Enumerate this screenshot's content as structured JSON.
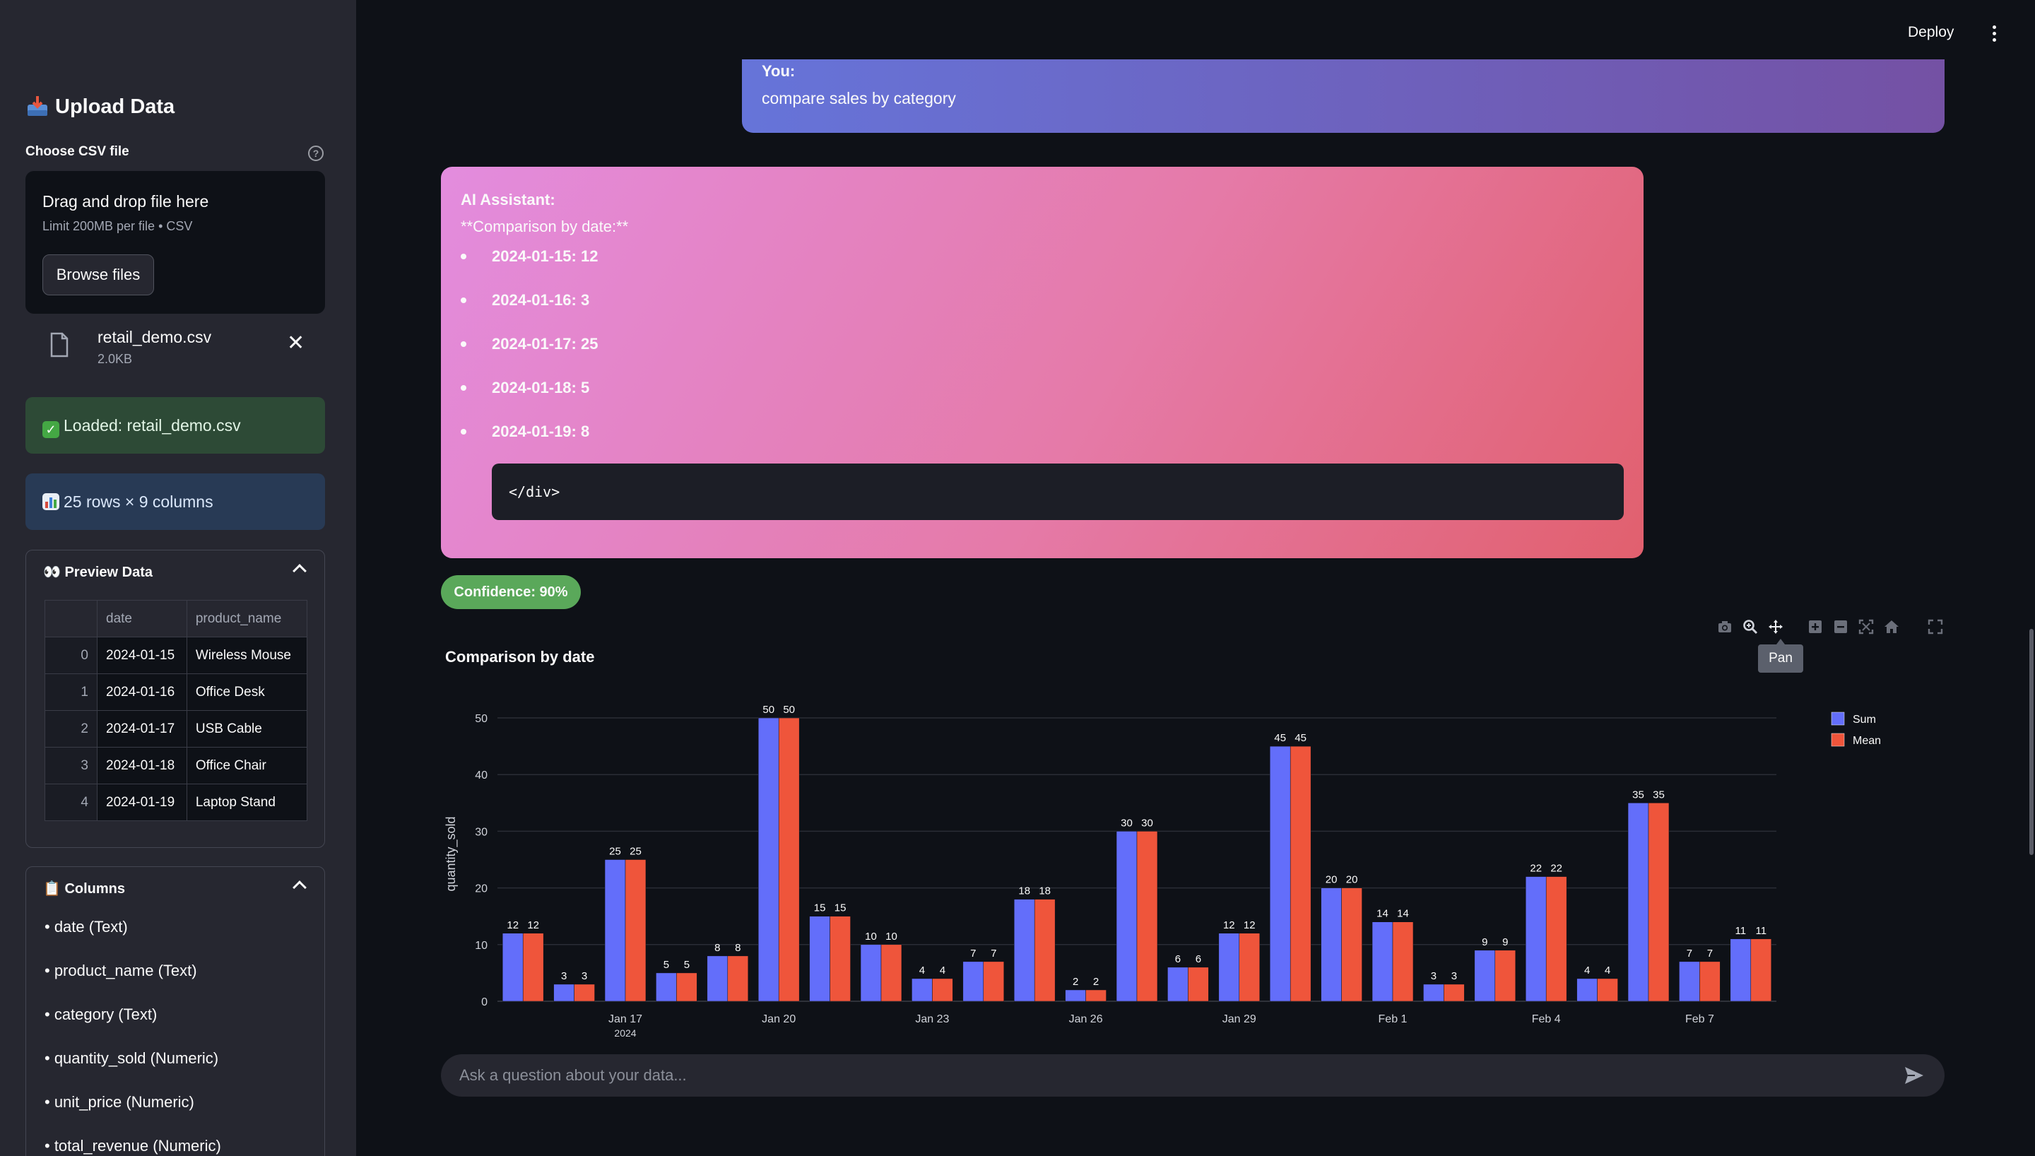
{
  "header": {
    "deploy_label": "Deploy"
  },
  "sidebar": {
    "title": "Upload Data",
    "uploader_label": "Choose CSV file",
    "dropzone": {
      "title": "Drag and drop file here",
      "limit": "Limit 200MB per file • CSV",
      "browse_label": "Browse files"
    },
    "file": {
      "name": "retail_demo.csv",
      "size": "2.0KB"
    },
    "success_msg": "Loaded: retail_demo.csv",
    "info_msg": "25 rows × 9 columns",
    "preview": {
      "title": "Preview Data",
      "columns": [
        "date",
        "product_name"
      ],
      "rows": [
        [
          "0",
          "2024-01-15",
          "Wireless Mouse"
        ],
        [
          "1",
          "2024-01-16",
          "Office Desk"
        ],
        [
          "2",
          "2024-01-17",
          "USB Cable"
        ],
        [
          "3",
          "2024-01-18",
          "Office Chair"
        ],
        [
          "4",
          "2024-01-19",
          "Laptop Stand"
        ]
      ]
    },
    "columns_panel": {
      "title": "Columns",
      "items": [
        "• date (Text)",
        "• product_name (Text)",
        "• category (Text)",
        "• quantity_sold (Numeric)",
        "• unit_price (Numeric)",
        "• total_revenue (Numeric)"
      ]
    }
  },
  "chat": {
    "user": {
      "who": "You:",
      "text": "compare sales by category"
    },
    "assistant": {
      "who": "AI Assistant:",
      "heading": "**Comparison by date:**",
      "items": [
        "2024-01-15: 12",
        "2024-01-16: 3",
        "2024-01-17: 25",
        "2024-01-18: 5",
        "2024-01-19: 8"
      ],
      "code": "</div>"
    },
    "confidence": "Confidence: 90%",
    "input_placeholder": "Ask a question about your data..."
  },
  "modebar": {
    "tooltip": "Pan"
  },
  "colors": {
    "sum": "#636efa",
    "mean": "#ef553b",
    "success_bg": "#2d4a36",
    "info_bg": "#283a55",
    "badge": "#5aa85a"
  },
  "chart_data": {
    "type": "bar",
    "title": "Comparison by date",
    "xlabel": "",
    "ylabel": "quantity_sold",
    "ylim": [
      0,
      52
    ],
    "yticks": [
      0,
      10,
      20,
      30,
      40,
      50
    ],
    "x": [
      "2024-01-15",
      "2024-01-16",
      "2024-01-17",
      "2024-01-18",
      "2024-01-19",
      "2024-01-20",
      "2024-01-21",
      "2024-01-22",
      "2024-01-23",
      "2024-01-24",
      "2024-01-25",
      "2024-01-26",
      "2024-01-27",
      "2024-01-28",
      "2024-01-29",
      "2024-01-30",
      "2024-01-31",
      "2024-02-01",
      "2024-02-02",
      "2024-02-03",
      "2024-02-04",
      "2024-02-05",
      "2024-02-06",
      "2024-02-07",
      "2024-02-08"
    ],
    "xtick_labels": [
      {
        "x": "2024-01-17",
        "label": "Jan 17",
        "sub": "2024"
      },
      {
        "x": "2024-01-20",
        "label": "Jan 20"
      },
      {
        "x": "2024-01-23",
        "label": "Jan 23"
      },
      {
        "x": "2024-01-26",
        "label": "Jan 26"
      },
      {
        "x": "2024-01-29",
        "label": "Jan 29"
      },
      {
        "x": "2024-02-01",
        "label": "Feb 1"
      },
      {
        "x": "2024-02-04",
        "label": "Feb 4"
      },
      {
        "x": "2024-02-07",
        "label": "Feb 7"
      }
    ],
    "series": [
      {
        "name": "Sum",
        "color": "#636efa",
        "values": [
          12,
          3,
          25,
          5,
          8,
          50,
          15,
          10,
          4,
          7,
          18,
          2,
          30,
          6,
          12,
          45,
          20,
          14,
          3,
          9,
          22,
          4,
          35,
          7,
          11
        ]
      },
      {
        "name": "Mean",
        "color": "#ef553b",
        "values": [
          12,
          3,
          25,
          5,
          8,
          50,
          15,
          10,
          4,
          7,
          18,
          2,
          30,
          6,
          12,
          45,
          20,
          14,
          3,
          9,
          22,
          4,
          35,
          7,
          11
        ]
      }
    ],
    "legend": "top-right",
    "grid": true
  }
}
